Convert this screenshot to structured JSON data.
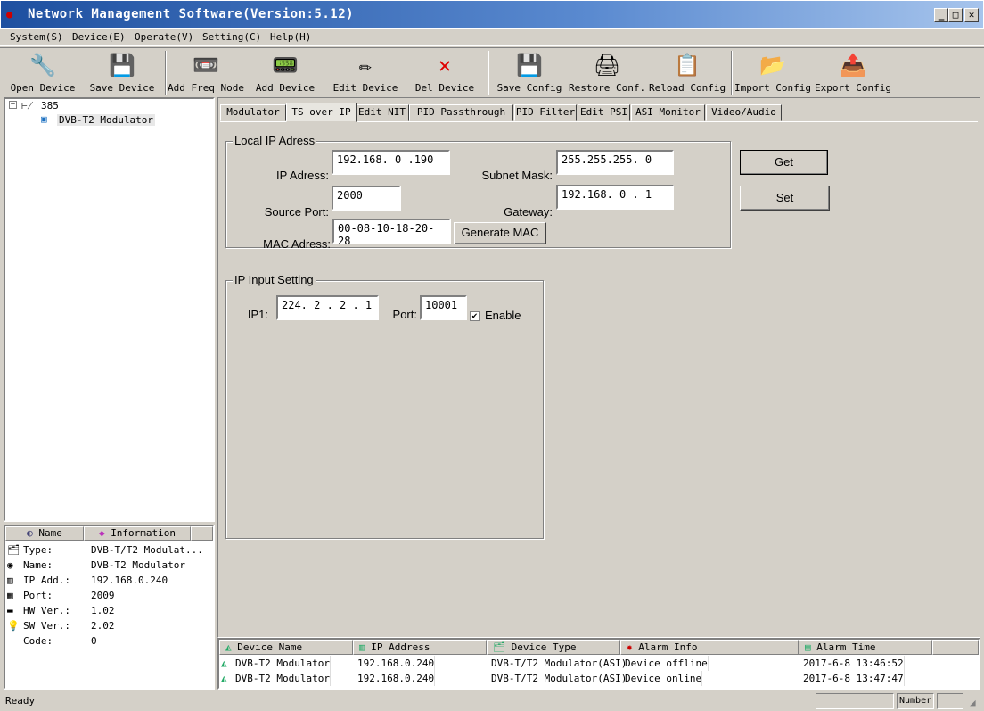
{
  "window": {
    "title": "Network Management Software(Version:5.12)"
  },
  "menu": [
    "System(S)",
    "Device(E)",
    "Operate(V)",
    "Setting(C)",
    "Help(H)"
  ],
  "toolbar": [
    {
      "label": "Open Device",
      "icon": "open-device-icon",
      "glyph": "🔧"
    },
    {
      "label": "Save Device",
      "icon": "save-device-icon",
      "glyph": "💾"
    },
    {
      "label": "Add Freq Node",
      "icon": "add-freq-node-icon",
      "glyph": "📼"
    },
    {
      "label": "Add Device",
      "icon": "add-device-icon",
      "glyph": "📟"
    },
    {
      "label": "Edit Device",
      "icon": "edit-device-icon",
      "glyph": "✏"
    },
    {
      "label": "Del Device",
      "icon": "delete-icon",
      "glyph": "✕"
    },
    {
      "label": "Save Config",
      "icon": "save-config-icon",
      "glyph": "💾"
    },
    {
      "label": "Restore Conf.",
      "icon": "restore-config-icon",
      "glyph": "🖨"
    },
    {
      "label": "Reload Config",
      "icon": "reload-config-icon",
      "glyph": "📋"
    },
    {
      "label": "Import Config",
      "icon": "import-config-icon",
      "glyph": "📂"
    },
    {
      "label": "Export Config",
      "icon": "export-config-icon",
      "glyph": "📤"
    }
  ],
  "tree": {
    "root": "385",
    "child": "DVB-T2 Modulator"
  },
  "info": {
    "headers": [
      "Name",
      "Information"
    ],
    "rows": [
      {
        "name": "Type:",
        "value": "DVB-T/T2 Modulat..."
      },
      {
        "name": "Name:",
        "value": "DVB-T2 Modulator"
      },
      {
        "name": "IP Add.:",
        "value": "192.168.0.240"
      },
      {
        "name": "Port:",
        "value": "2009"
      },
      {
        "name": "HW Ver.:",
        "value": "1.02"
      },
      {
        "name": "SW Ver.:",
        "value": "2.02"
      },
      {
        "name": "Code:",
        "value": "0"
      }
    ]
  },
  "tabs": [
    "Modulator",
    "TS over IP",
    "Edit NIT",
    "PID Passthrough",
    "PID Filter",
    "Edit PSI",
    "ASI Monitor",
    "Video/Audio"
  ],
  "active_tab": "TS over IP",
  "local_ip": {
    "title": "Local IP Adress",
    "ip_label": "IP Adress:",
    "ip": "192.168. 0 .190",
    "mask_label": "Subnet Mask:",
    "mask": "255.255.255. 0",
    "port_label": "Source Port:",
    "port": "2000",
    "gw_label": "Gateway:",
    "gw": "192.168. 0 . 1",
    "mac_label": "MAC Adress:",
    "mac": "00-08-10-18-20-28",
    "gen_mac": "Generate MAC"
  },
  "buttons": {
    "get": "Get",
    "set": "Set"
  },
  "ip_input": {
    "title": "IP Input Setting",
    "ip1_label": "IP1:",
    "ip1": "224. 2 . 2 . 1",
    "port_label": "Port:",
    "port": "10001",
    "enable_label": "Enable",
    "enabled": true
  },
  "alarms": {
    "headers": [
      "Device Name",
      "IP Address",
      "Device Type",
      "Alarm Info",
      "Alarm Time"
    ],
    "rows": [
      [
        "DVB-T2 Modulator",
        "192.168.0.240",
        "DVB-T/T2 Modulator(ASI)",
        "Device offline",
        "2017-6-8 13:46:52"
      ],
      [
        "DVB-T2 Modulator",
        "192.168.0.240",
        "DVB-T/T2 Modulator(ASI)",
        "Device online",
        "2017-6-8 13:47:47"
      ]
    ]
  },
  "status": {
    "text": "Ready",
    "number_label": "Number"
  }
}
